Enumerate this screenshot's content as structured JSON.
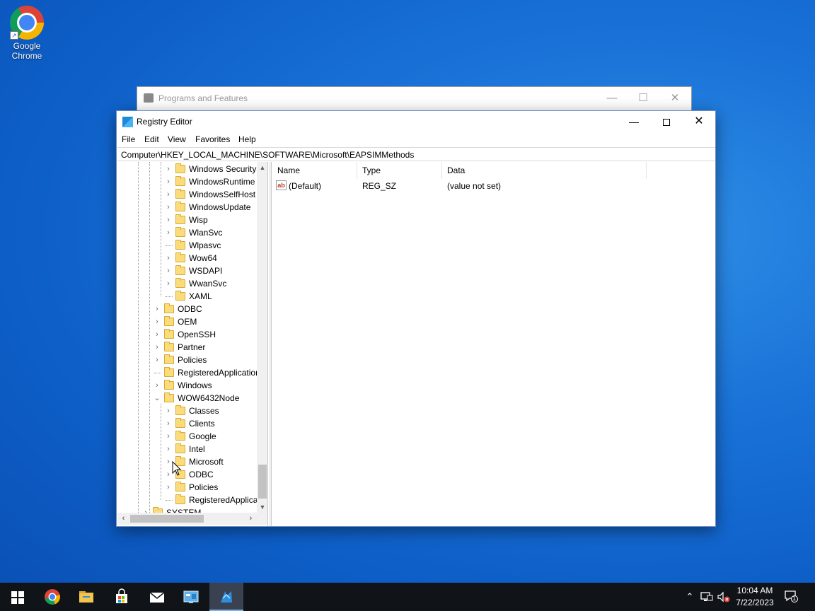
{
  "desktop": {
    "icons": [
      {
        "label_line1": "Google",
        "label_line2": "Chrome",
        "icon": "chrome-icon"
      }
    ]
  },
  "background_window": {
    "title": "Programs and Features"
  },
  "window": {
    "title": "Registry Editor",
    "menu": [
      "File",
      "Edit",
      "View",
      "Favorites",
      "Help"
    ],
    "address": "Computer\\HKEY_LOCAL_MACHINE\\SOFTWARE\\Microsoft\\EAPSIMMethods",
    "tree": [
      {
        "label": "Windows Security",
        "level": 2,
        "expander": true
      },
      {
        "label": "WindowsRuntime",
        "level": 2,
        "expander": true
      },
      {
        "label": "WindowsSelfHost",
        "level": 2,
        "expander": true
      },
      {
        "label": "WindowsUpdate",
        "level": 2,
        "expander": true
      },
      {
        "label": "Wisp",
        "level": 2,
        "expander": true
      },
      {
        "label": "WlanSvc",
        "level": 2,
        "expander": true
      },
      {
        "label": "Wlpasvc",
        "level": 2,
        "expander": false
      },
      {
        "label": "Wow64",
        "level": 2,
        "expander": true
      },
      {
        "label": "WSDAPI",
        "level": 2,
        "expander": true
      },
      {
        "label": "WwanSvc",
        "level": 2,
        "expander": true
      },
      {
        "label": "XAML",
        "level": 2,
        "expander": false
      },
      {
        "label": "ODBC",
        "level": 1,
        "expander": true
      },
      {
        "label": "OEM",
        "level": 1,
        "expander": true
      },
      {
        "label": "OpenSSH",
        "level": 1,
        "expander": true
      },
      {
        "label": "Partner",
        "level": 1,
        "expander": true
      },
      {
        "label": "Policies",
        "level": 1,
        "expander": true
      },
      {
        "label": "RegisteredApplications",
        "level": 1,
        "expander": false
      },
      {
        "label": "Windows",
        "level": 1,
        "expander": true
      },
      {
        "label": "WOW6432Node",
        "level": 1,
        "expander": true,
        "expanded": true
      },
      {
        "label": "Classes",
        "level": 2,
        "expander": true
      },
      {
        "label": "Clients",
        "level": 2,
        "expander": true
      },
      {
        "label": "Google",
        "level": 2,
        "expander": true
      },
      {
        "label": "Intel",
        "level": 2,
        "expander": true
      },
      {
        "label": "Microsoft",
        "level": 2,
        "expander": true
      },
      {
        "label": "ODBC",
        "level": 2,
        "expander": true
      },
      {
        "label": "Policies",
        "level": 2,
        "expander": true
      },
      {
        "label": "RegisteredApplications",
        "level": 2,
        "expander": false
      },
      {
        "label": "SYSTEM",
        "level": 0,
        "expander": true
      }
    ],
    "list": {
      "columns": [
        "Name",
        "Type",
        "Data"
      ],
      "rows": [
        {
          "name": "(Default)",
          "type": "REG_SZ",
          "data": "(value not set)",
          "icon": "string-value-icon"
        }
      ]
    }
  },
  "taskbar": {
    "items": [
      "start-icon",
      "chrome-icon",
      "file-explorer-icon",
      "store-icon",
      "mail-icon",
      "control-panel-icon",
      "registry-editor-icon"
    ],
    "active_item": "registry-editor-icon",
    "tray": [
      "chevron-up-icon",
      "network-icon",
      "volume-muted-icon"
    ],
    "time": "10:04 AM",
    "date": "7/22/2023",
    "notification_count": "1"
  }
}
